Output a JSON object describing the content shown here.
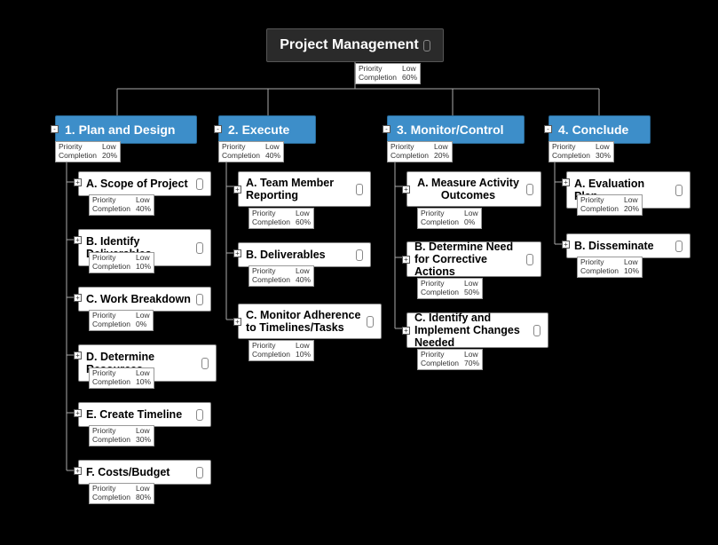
{
  "root": {
    "title": "Project Management",
    "priority_label": "Priority",
    "priority": "Low",
    "completion_label": "Completion",
    "completion": "60%"
  },
  "branches": [
    {
      "title": "1. Plan and Design",
      "priority_label": "Priority",
      "priority": "Low",
      "completion_label": "Completion",
      "completion": "20%",
      "children": [
        {
          "title": "A. Scope of Project",
          "priority_label": "Priority",
          "priority": "Low",
          "completion_label": "Completion",
          "completion": "40%"
        },
        {
          "title": "B. Identify Deliverables",
          "priority_label": "Priority",
          "priority": "Low",
          "completion_label": "Completion",
          "completion": "10%"
        },
        {
          "title": "C. Work Breakdown",
          "priority_label": "Priority",
          "priority": "Low",
          "completion_label": "Completion",
          "completion": "0%"
        },
        {
          "title": "D. Determine Resources",
          "priority_label": "Priority",
          "priority": "Low",
          "completion_label": "Completion",
          "completion": "10%"
        },
        {
          "title": "E. Create Timeline",
          "priority_label": "Priority",
          "priority": "Low",
          "completion_label": "Completion",
          "completion": "30%"
        },
        {
          "title": "F. Costs/Budget",
          "priority_label": "Priority",
          "priority": "Low",
          "completion_label": "Completion",
          "completion": "80%"
        }
      ]
    },
    {
      "title": "2. Execute",
      "priority_label": "Priority",
      "priority": "Low",
      "completion_label": "Completion",
      "completion": "40%",
      "children": [
        {
          "title": "A. Team Member Reporting",
          "priority_label": "Priority",
          "priority": "Low",
          "completion_label": "Completion",
          "completion": "60%"
        },
        {
          "title": "B. Deliverables",
          "priority_label": "Priority",
          "priority": "Low",
          "completion_label": "Completion",
          "completion": "40%"
        },
        {
          "title": "C. Monitor Adherence to Timelines/Tasks",
          "priority_label": "Priority",
          "priority": "Low",
          "completion_label": "Completion",
          "completion": "10%"
        }
      ]
    },
    {
      "title": "3. Monitor/Control",
      "priority_label": "Priority",
      "priority": "Low",
      "completion_label": "Completion",
      "completion": "20%",
      "children": [
        {
          "title": "A. Measure Activity Outcomes",
          "priority_label": "Priority",
          "priority": "Low",
          "completion_label": "Completion",
          "completion": "0%"
        },
        {
          "title": "B. Determine Need for Corrective Actions",
          "priority_label": "Priority",
          "priority": "Low",
          "completion_label": "Completion",
          "completion": "50%"
        },
        {
          "title": "C. Identify and Implement Changes Needed",
          "priority_label": "Priority",
          "priority": "Low",
          "completion_label": "Completion",
          "completion": "70%"
        }
      ]
    },
    {
      "title": "4. Conclude",
      "priority_label": "Priority",
      "priority": "Low",
      "completion_label": "Completion",
      "completion": "30%",
      "children": [
        {
          "title": "A. Evaluation Plan",
          "priority_label": "Priority",
          "priority": "Low",
          "completion_label": "Completion",
          "completion": "20%"
        },
        {
          "title": "B. Disseminate",
          "priority_label": "Priority",
          "priority": "Low",
          "completion_label": "Completion",
          "completion": "10%"
        }
      ]
    }
  ]
}
